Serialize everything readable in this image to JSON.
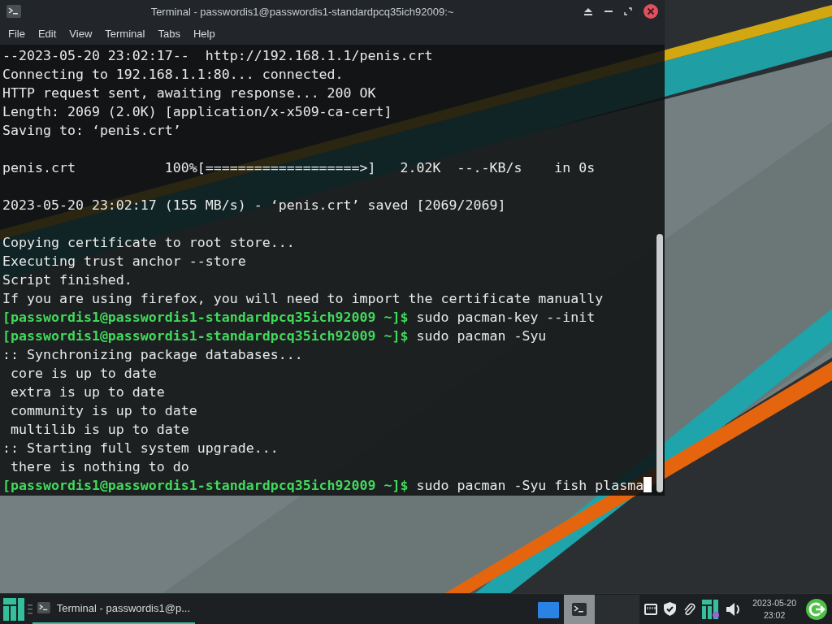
{
  "window": {
    "title": "Terminal - passwordis1@passwordis1-standardpcq35ich92009:~"
  },
  "menu": [
    "File",
    "Edit",
    "View",
    "Terminal",
    "Tabs",
    "Help"
  ],
  "terminal": {
    "lines": [
      {
        "kind": "output",
        "text": "--2023-05-20 23:02:17--  http://192.168.1.1/penis.crt"
      },
      {
        "kind": "output",
        "text": "Connecting to 192.168.1.1:80... connected."
      },
      {
        "kind": "output",
        "text": "HTTP request sent, awaiting response... 200 OK"
      },
      {
        "kind": "output",
        "text": "Length: 2069 (2.0K) [application/x-x509-ca-cert]"
      },
      {
        "kind": "output",
        "text": "Saving to: ‘penis.crt’"
      },
      {
        "kind": "blank"
      },
      {
        "kind": "output",
        "text": "penis.crt           100%[===================>]   2.02K  --.-KB/s    in 0s"
      },
      {
        "kind": "blank"
      },
      {
        "kind": "output",
        "text": "2023-05-20 23:02:17 (155 MB/s) - ‘penis.crt’ saved [2069/2069]"
      },
      {
        "kind": "blank"
      },
      {
        "kind": "output",
        "text": "Copying certificate to root store..."
      },
      {
        "kind": "output",
        "text": "Executing trust anchor --store"
      },
      {
        "kind": "output",
        "text": "Script finished."
      },
      {
        "kind": "output",
        "text": "If you are using firefox, you will need to import the certificate manually"
      },
      {
        "kind": "prompt",
        "prompt": "[passwordis1@passwordis1-standardpcq35ich92009 ~]$",
        "command": "sudo pacman-key --init",
        "cursor": false
      },
      {
        "kind": "prompt",
        "prompt": "[passwordis1@passwordis1-standardpcq35ich92009 ~]$",
        "command": "sudo pacman -Syu",
        "cursor": false
      },
      {
        "kind": "output",
        "text": ":: Synchronizing package databases..."
      },
      {
        "kind": "output",
        "text": " core is up to date"
      },
      {
        "kind": "output",
        "text": " extra is up to date"
      },
      {
        "kind": "output",
        "text": " community is up to date"
      },
      {
        "kind": "output",
        "text": " multilib is up to date"
      },
      {
        "kind": "output",
        "text": ":: Starting full system upgrade..."
      },
      {
        "kind": "output",
        "text": " there is nothing to do"
      },
      {
        "kind": "prompt",
        "prompt": "[passwordis1@passwordis1-standardpcq35ich92009 ~]$",
        "command": "sudo pacman -Syu fish plasma",
        "cursor": true
      }
    ]
  },
  "taskbar": {
    "task": {
      "label": "Terminal - passwordis1@p...",
      "selected": true
    },
    "workspaces": [
      {
        "selected": true
      },
      {
        "selected": false
      }
    ],
    "clock": {
      "date": "2023-05-20",
      "time": "23:02"
    }
  }
}
